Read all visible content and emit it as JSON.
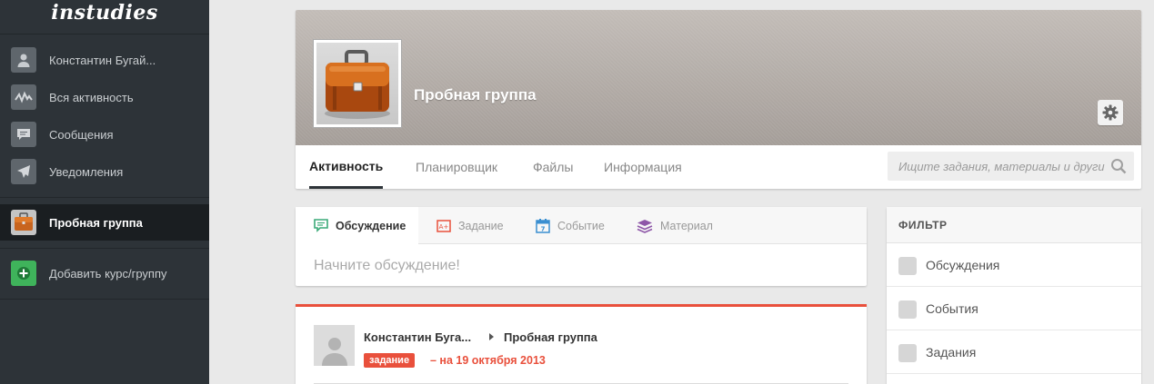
{
  "app": {
    "logo": "instudies"
  },
  "sidebar": {
    "items": [
      {
        "label": "Константин Бугай...",
        "icon": "user-icon"
      },
      {
        "label": "Вся активность",
        "icon": "activity-icon"
      },
      {
        "label": "Сообщения",
        "icon": "message-icon"
      },
      {
        "label": "Уведомления",
        "icon": "notification-icon"
      },
      {
        "label": "Пробная группа",
        "icon": "briefcase-icon",
        "active": true
      },
      {
        "label": "Добавить курс/группу",
        "icon": "add-icon"
      }
    ]
  },
  "group": {
    "title": "Пробная группа",
    "tabs": [
      {
        "label": "Активность",
        "active": true
      },
      {
        "label": "Планировщик"
      },
      {
        "label": "Файлы"
      },
      {
        "label": "Информация"
      }
    ],
    "search_placeholder": "Ищите задания, материалы и други"
  },
  "composer": {
    "tabs": [
      {
        "label": "Обсуждение",
        "icon": "discussion-icon",
        "active": true
      },
      {
        "label": "Задание",
        "icon": "assignment-icon"
      },
      {
        "label": "Событие",
        "icon": "calendar-icon"
      },
      {
        "label": "Материал",
        "icon": "material-icon"
      }
    ],
    "placeholder": "Начните обсуждение!"
  },
  "post": {
    "author": "Константин Буга...",
    "group": "Пробная группа",
    "badge": "задание",
    "due": "– на 19 октября 2013"
  },
  "filter": {
    "title": "ФИЛЬТР",
    "options": [
      {
        "label": "Обсуждения",
        "checked": false
      },
      {
        "label": "События",
        "checked": false
      },
      {
        "label": "Задания",
        "checked": false
      }
    ]
  },
  "colors": {
    "sidebar_bg": "#2d3338",
    "accent_red": "#e9503c",
    "add_green": "#3fb35b",
    "discussion_green": "#3aaa78",
    "assignment_red": "#e9503c",
    "calendar_blue": "#3a8fd1",
    "material_purple": "#8e57a8"
  }
}
